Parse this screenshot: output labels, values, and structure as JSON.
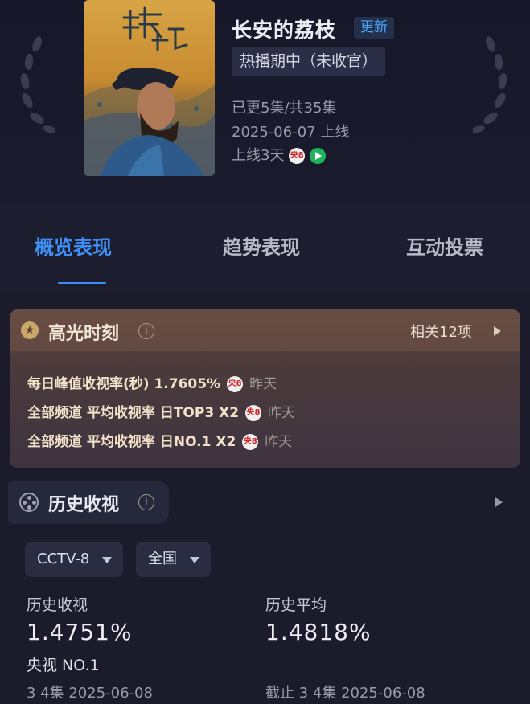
{
  "show": {
    "title": "长安的荔枝",
    "update_badge": "更新",
    "status": "热播期中（未收官）",
    "episodes": "已更5集/共35集",
    "premiere": "2025-06-07 上线",
    "days_online": "上线3天",
    "channel_icon_text": "央8"
  },
  "tabs": [
    {
      "label": "概览表现",
      "active": true
    },
    {
      "label": "趋势表现",
      "active": false
    },
    {
      "label": "互动投票",
      "active": false
    }
  ],
  "highlights": {
    "title": "高光时刻",
    "related": "相关12项",
    "items": [
      {
        "text": "每日峰值收视率(秒)  1.7605%",
        "when": "昨天"
      },
      {
        "text": "全部频道 平均收视率  日TOP3 X2",
        "when": "昨天"
      },
      {
        "text": "全部频道 平均收视率  日NO.1 X2",
        "when": "昨天"
      }
    ]
  },
  "history": {
    "title": "历史收视",
    "channel_select": "CCTV-8",
    "region_select": "全国",
    "rating_label": "历史收视",
    "rating_value": "1.4751%",
    "rank": "央视 NO.1",
    "rating_date": "3 4集  2025-06-08",
    "avg_label": "历史平均",
    "avg_value": "1.4818%",
    "avg_date": "截止 3 4集  2025-06-08"
  },
  "colors": {
    "accent": "#3f8ef5",
    "background": "#1b1b2b",
    "highlight_card": "#4a3a3c"
  }
}
